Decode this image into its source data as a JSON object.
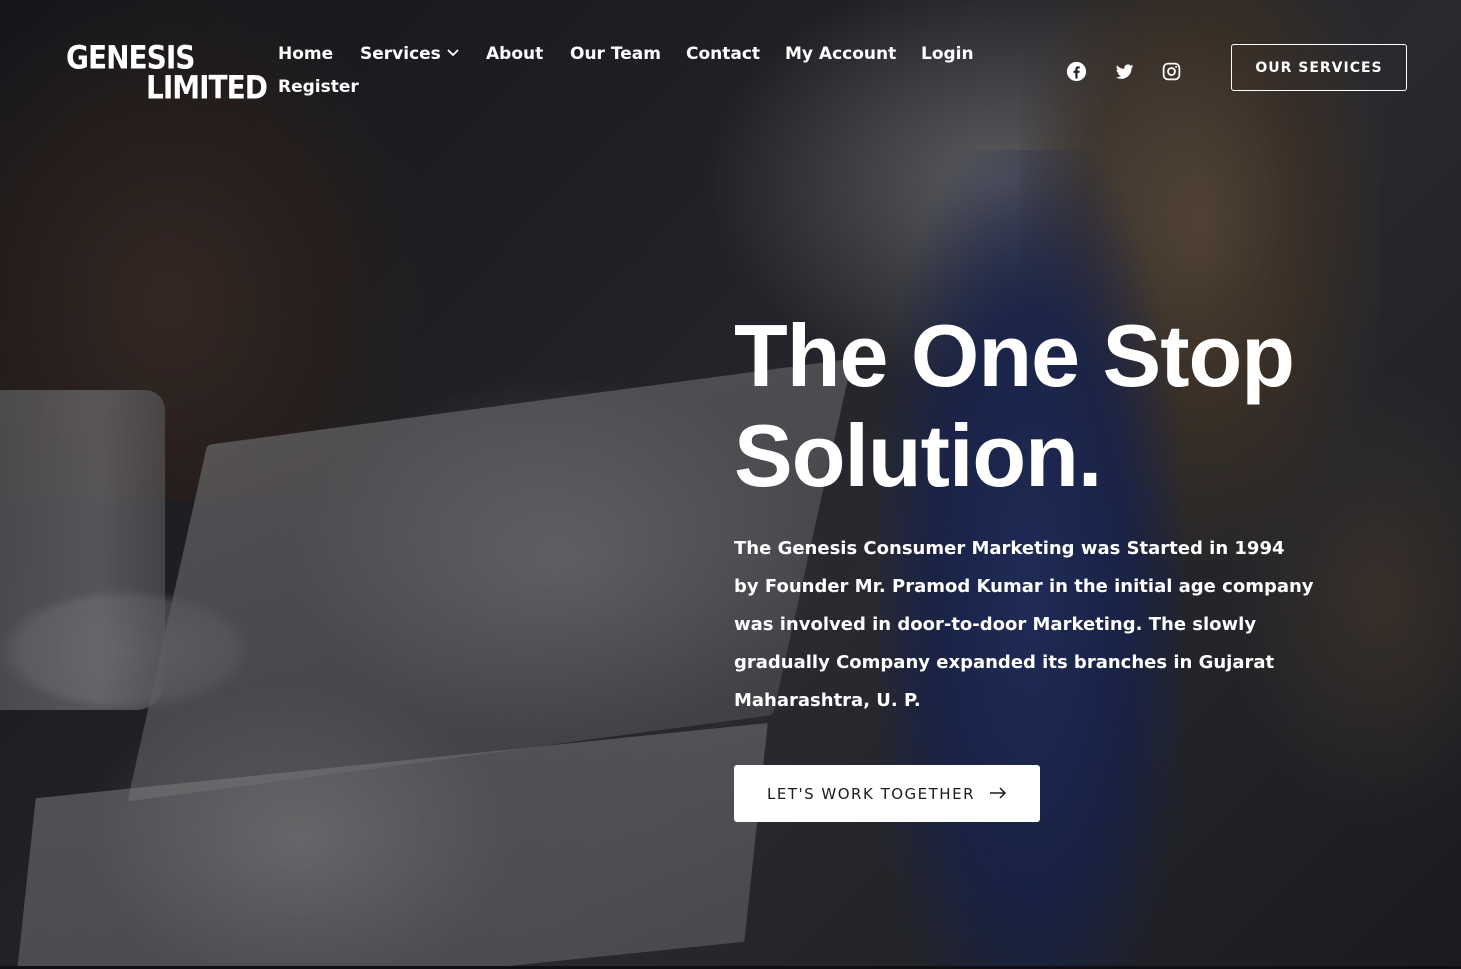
{
  "logo": {
    "line1": "GENESIS",
    "line2": "LIMITED"
  },
  "nav": {
    "items": [
      {
        "label": "Home"
      },
      {
        "label": "Services",
        "has_dropdown": true,
        "dropdown_icon": "chevron-down-icon"
      },
      {
        "label": "About"
      },
      {
        "label": "Our Team"
      },
      {
        "label": "Contact"
      },
      {
        "label": "My Account"
      },
      {
        "label": "Login"
      },
      {
        "label": "Register"
      }
    ]
  },
  "social": [
    {
      "name": "facebook",
      "icon": "facebook-icon"
    },
    {
      "name": "twitter",
      "icon": "twitter-icon"
    },
    {
      "name": "instagram",
      "icon": "instagram-icon"
    }
  ],
  "header_cta": {
    "label": "OUR SERVICES"
  },
  "hero": {
    "title_line1": "The One Stop",
    "title_line2": "Solution.",
    "description": "The Genesis Consumer Marketing was Started in 1994 by Founder Mr. Pramod Kumar in the initial age company was involved in door-to-door Marketing. The slowly gradually Company expanded its branches in Gujarat  Maharashtra, U. P.",
    "cta_label": "LET'S WORK TOGETHER",
    "cta_icon": "arrow-right-icon"
  },
  "colors": {
    "text": "#ffffff",
    "button_bg": "#ffffff",
    "button_text": "#1c1c1c",
    "overlay": "#0c0c10"
  }
}
